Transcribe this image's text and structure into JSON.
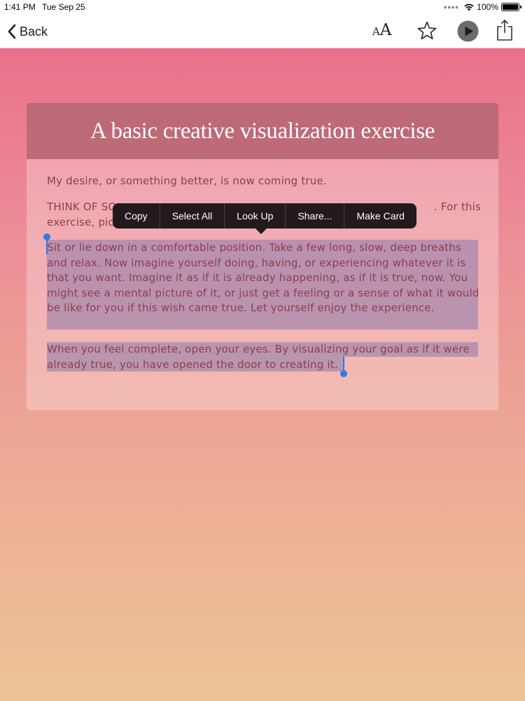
{
  "status": {
    "time": "1:41 PM",
    "date": "Tue Sep 25",
    "battery": "100%"
  },
  "nav": {
    "back_label": "Back",
    "font_icon_small": "A",
    "font_icon_big": "A"
  },
  "card": {
    "title": "A basic creative visualization exercise",
    "paragraphs": {
      "p1": "My desire, or something better, is now coming true.",
      "p2_line1_start": "THINK OF SO",
      "p2_line1_end": ". For this",
      "p2_line2": "exercise, pic",
      "p3": "Sit or lie down in a comfortable position. Take a few long, slow, deep breaths and relax. Now imagine yourself doing, having, or experiencing whatever it is that you want. Imagine it as if it is already happening, as if it is true, now. You might see a mental picture of it, or just get a feeling or a sense of what it would be like for you if this wish came true. Let yourself enjoy the experience.",
      "p4": "When you feel complete, open your eyes. By visualizing your goal as if it were already true, you have opened the door to creating it."
    }
  },
  "context_menu": {
    "copy": "Copy",
    "select_all": "Select All",
    "look_up": "Look Up",
    "share": "Share...",
    "make_card": "Make Card"
  },
  "colors": {
    "gradient_top": "#e9698a",
    "gradient_bottom": "#edc496",
    "selection": "#8c78aa",
    "handle": "#2c7be5",
    "text": "#8a3f4e"
  },
  "icons": [
    "chevron-left-icon",
    "font-size-icon",
    "star-icon",
    "play-icon",
    "share-icon",
    "wifi-icon",
    "battery-icon"
  ]
}
